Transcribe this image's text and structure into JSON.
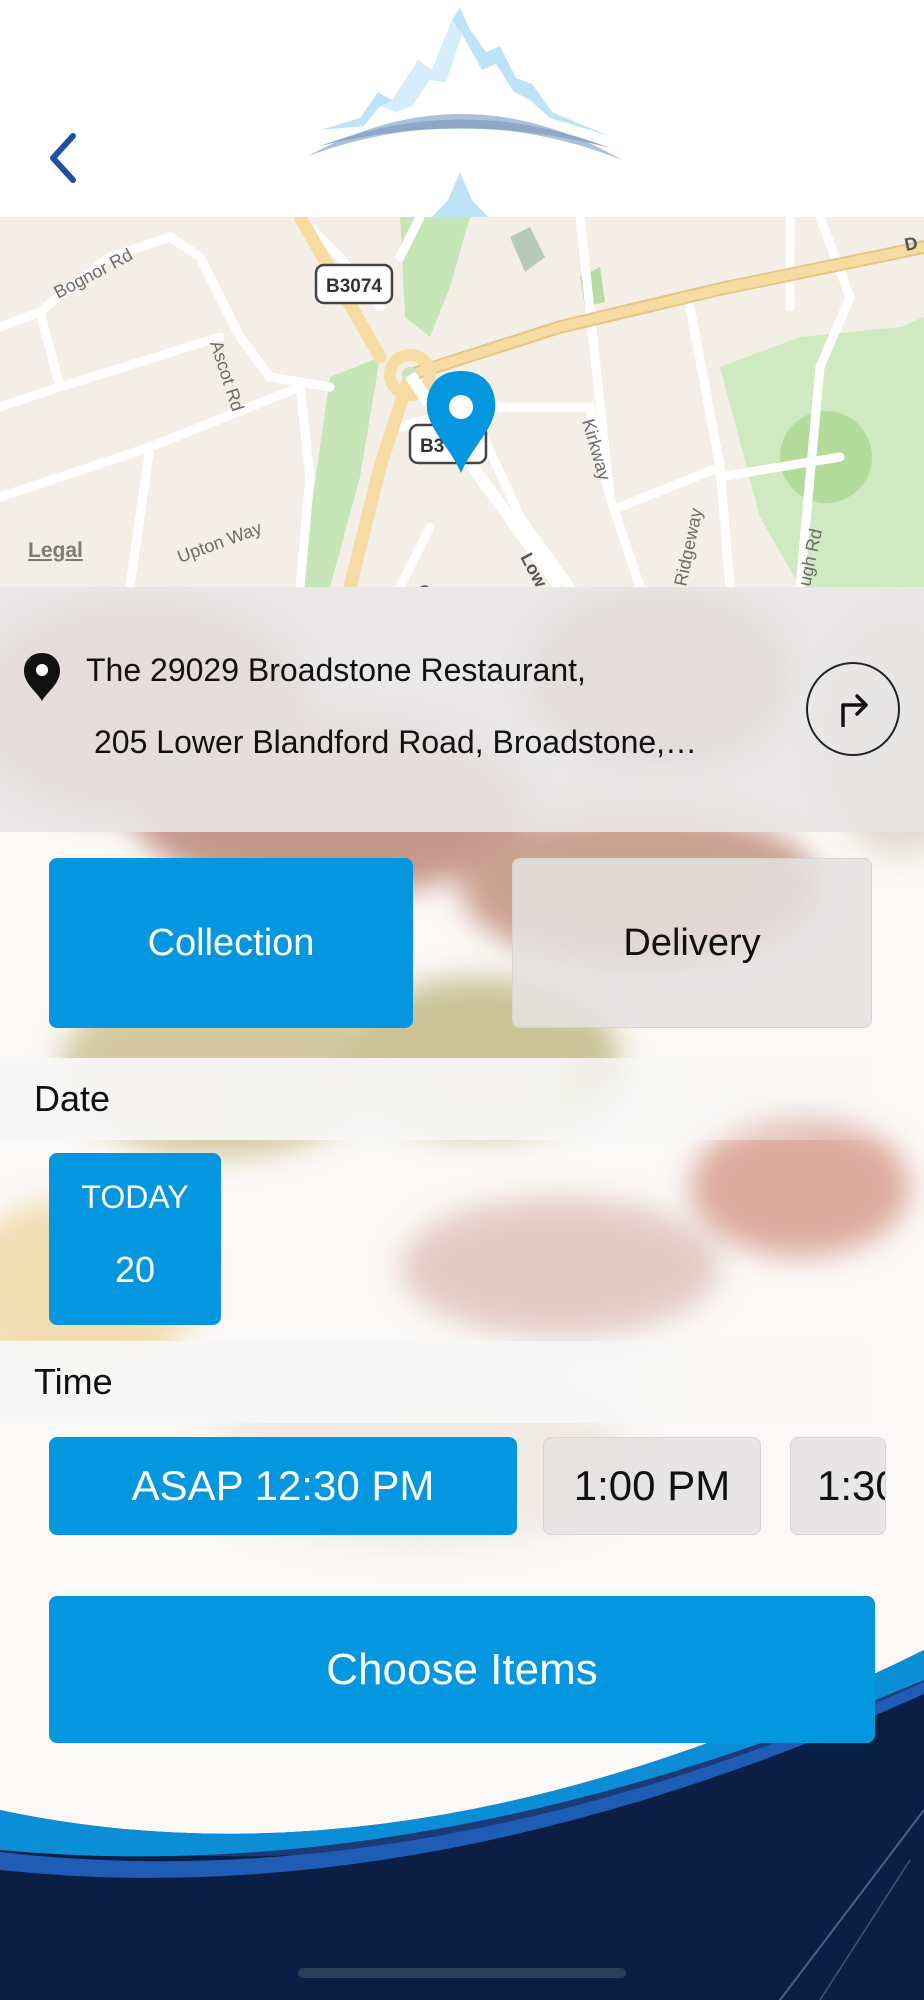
{
  "map": {
    "legal_label": "Legal",
    "road_labels": [
      "Bognor Rd",
      "Ascot Rd",
      "Upton Way",
      "Kirkway",
      "Ridgeway",
      "Gr",
      "Low",
      "D",
      "ugh Rd"
    ],
    "road_badge_top": "B3074",
    "road_badge_bottom": "B3"
  },
  "address": {
    "line1": "The 29029 Broadstone Restaurant,",
    "line2": "205 Lower Blandford Road, Broadstone,…"
  },
  "order_type": {
    "collection_label": "Collection",
    "delivery_label": "Delivery",
    "selected": "Collection"
  },
  "date_section": {
    "title": "Date",
    "options": [
      {
        "top": "TODAY",
        "bottom": "20",
        "selected": true
      }
    ]
  },
  "time_section": {
    "title": "Time",
    "options": [
      {
        "label": "ASAP 12:30 PM",
        "selected": true
      },
      {
        "label": "1:00 PM",
        "selected": false
      },
      {
        "label": "1:30",
        "selected": false
      }
    ]
  },
  "actions": {
    "choose_items_label": "Choose Items"
  },
  "icons": {
    "back": "chevron-left-icon",
    "map_pin": "map-pin-icon",
    "location": "location-pin-icon",
    "directions": "turn-right-arrow-icon"
  },
  "colors": {
    "accent": "#0596e0",
    "back_arrow": "#1d4fa3",
    "map_pin": "#0596e0"
  }
}
